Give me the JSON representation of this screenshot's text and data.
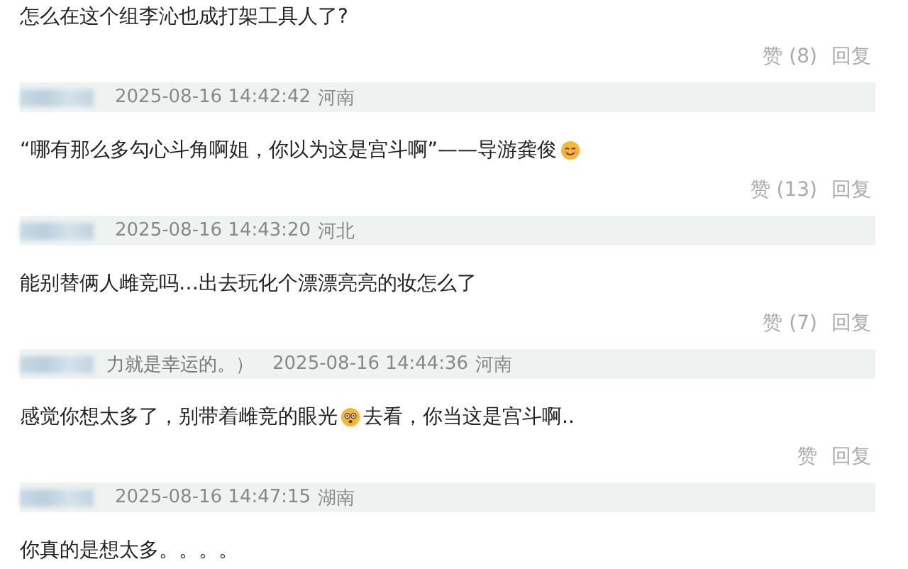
{
  "comments": [
    {
      "segments": [
        {
          "kind": "text",
          "text": "怎么在这个组李沁也成打架工具人了?"
        }
      ],
      "like": "赞 (8)",
      "reply": "回复"
    },
    {
      "header": {
        "time": "2025-08-16 14:42:42",
        "region": "河南"
      },
      "segments": [
        {
          "kind": "text",
          "text": "“哪有那么多勾心斗角啊姐，你以为这是宫斗啊”——导游龚俊"
        },
        {
          "kind": "smile"
        }
      ],
      "like": "赞 (13)",
      "reply": "回复"
    },
    {
      "header": {
        "time": "2025-08-16 14:43:20",
        "region": "河北"
      },
      "segments": [
        {
          "kind": "text",
          "text": "能别替俩人雌竞吗…出去玩化个漂漂亮亮的妆怎么了"
        }
      ],
      "like": "赞 (7)",
      "reply": "回复"
    },
    {
      "header": {
        "signature": "力就是幸运的。）",
        "time": "2025-08-16 14:44:36",
        "region": "河南"
      },
      "segments": [
        {
          "kind": "text",
          "text": "感觉你想太多了，别带着雌竞的眼光"
        },
        {
          "kind": "dizzy"
        },
        {
          "kind": "text",
          "text": "去看，你当这是宫斗啊.."
        }
      ],
      "like": "赞",
      "reply": "回复"
    },
    {
      "header": {
        "time": "2025-08-16 14:47:15",
        "region": "湖南"
      },
      "segments": [
        {
          "kind": "text",
          "text": "你真的是想太多。。。。"
        }
      ]
    }
  ]
}
